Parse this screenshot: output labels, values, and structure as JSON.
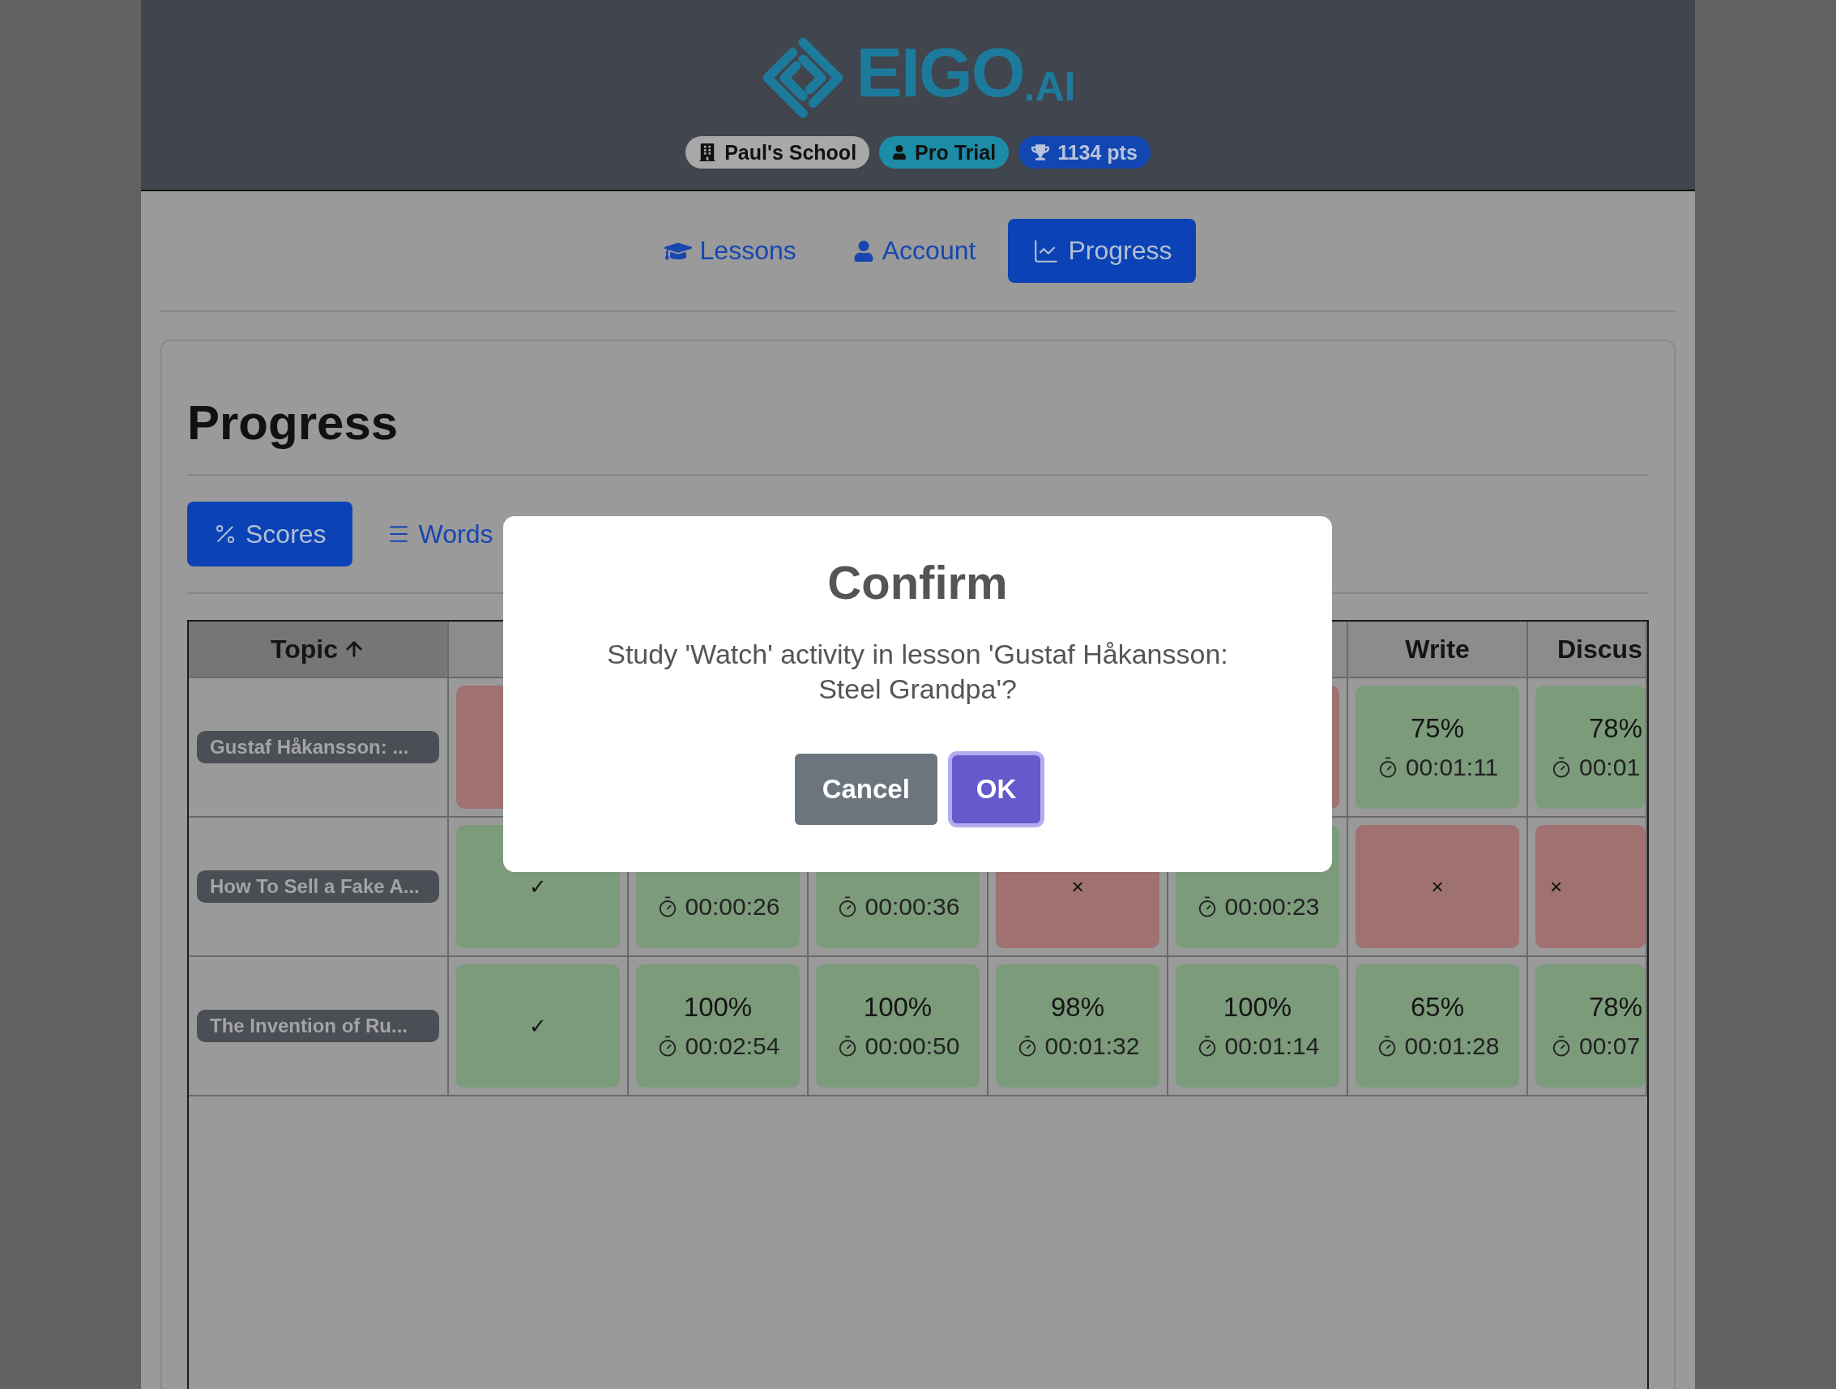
{
  "logo": {
    "name": "EIGO",
    "suffix": ".AI"
  },
  "badges": [
    {
      "kind": "school",
      "label": "Paul's School"
    },
    {
      "kind": "plan",
      "label": "Pro Trial"
    },
    {
      "kind": "points",
      "label": "1134 pts"
    }
  ],
  "nav": [
    {
      "kind": "lessons",
      "label": "Lessons",
      "selected": false
    },
    {
      "kind": "account",
      "label": "Account",
      "selected": false
    },
    {
      "kind": "progress",
      "label": "Progress",
      "selected": true
    }
  ],
  "page_title": "Progress",
  "view_tabs": [
    {
      "kind": "scores",
      "label": "Scores",
      "selected": true
    },
    {
      "kind": "words",
      "label": "Words",
      "selected": false
    }
  ],
  "table": {
    "columns": [
      {
        "label": "Topic",
        "sorted_ascending": true
      },
      {},
      {},
      {},
      {},
      {},
      {
        "label": "Write"
      },
      {
        "label": "Discus"
      }
    ],
    "rows": [
      {
        "cells": [
          {
            "kind": "topic",
            "label": "Gustaf Håkansson: ..."
          },
          {
            "kind": "fail"
          },
          null,
          null,
          null,
          {
            "kind": "fail"
          },
          {
            "kind": "score",
            "score": "75%",
            "time": "00:01:11"
          },
          {
            "kind": "score",
            "score": "78%",
            "time": "00:01"
          }
        ]
      },
      {
        "cells": [
          {
            "kind": "topic",
            "label": "How To Sell a Fake A..."
          },
          {
            "kind": "check",
            "mark": "✓"
          },
          {
            "kind": "score",
            "time": "00:00:26"
          },
          {
            "kind": "score",
            "time": "00:00:36"
          },
          {
            "kind": "fail",
            "mark": "×"
          },
          {
            "kind": "score",
            "time": "00:00:23"
          },
          {
            "kind": "fail",
            "mark": "×"
          },
          {
            "kind": "fail",
            "mark": "×"
          }
        ]
      },
      {
        "cells": [
          {
            "kind": "topic",
            "label": "The Invention of Ru..."
          },
          {
            "kind": "check",
            "mark": "✓"
          },
          {
            "kind": "score",
            "score": "100%",
            "time": "00:02:54"
          },
          {
            "kind": "score",
            "score": "100%",
            "time": "00:00:50"
          },
          {
            "kind": "score",
            "score": "98%",
            "time": "00:01:32"
          },
          {
            "kind": "score",
            "score": "100%",
            "time": "00:01:14"
          },
          {
            "kind": "score",
            "score": "65%",
            "time": "00:01:28"
          },
          {
            "kind": "score",
            "score": "78%",
            "time": "00:07"
          }
        ]
      }
    ]
  },
  "modal": {
    "title": "Confirm",
    "message": "Study 'Watch' activity in lesson 'Gustaf Håkansson: Steel Grandpa'?",
    "buttons": [
      {
        "kind": "secondary",
        "label": "Cancel",
        "focused": false
      },
      {
        "kind": "primary",
        "label": "OK",
        "focused": true
      }
    ]
  }
}
